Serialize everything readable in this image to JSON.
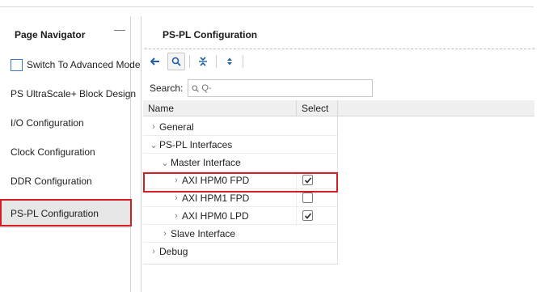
{
  "navigator": {
    "title": "Page Navigator",
    "minimize_icon": "minimize-icon",
    "items": [
      {
        "label": "Switch To Advanced Mode",
        "type": "checkbox",
        "checked": false
      },
      {
        "label": "PS UltraScale+ Block Design"
      },
      {
        "label": "I/O Configuration"
      },
      {
        "label": "Clock Configuration"
      },
      {
        "label": "DDR Configuration"
      },
      {
        "label": "PS-PL Configuration",
        "selected": true
      }
    ]
  },
  "config": {
    "title": "PS-PL Configuration",
    "toolbar": {
      "icons": [
        "back-arrow-icon",
        "search-icon",
        "collapse-all-icon",
        "expand-all-icon"
      ]
    },
    "search": {
      "label": "Search:",
      "value": "",
      "placeholder": "Q-"
    },
    "columns": {
      "name": "Name",
      "select": "Select"
    },
    "rows": [
      {
        "label": "General",
        "caret": "›",
        "level": 0,
        "expanded": false
      },
      {
        "label": "PS-PL Interfaces",
        "caret": "⌄",
        "level": 0,
        "expanded": true
      },
      {
        "label": "Master Interface",
        "caret": "⌄",
        "level": 1,
        "expanded": true
      },
      {
        "label": "AXI HPM0 FPD",
        "caret": "›",
        "level": 2,
        "checked": true
      },
      {
        "label": "AXI HPM1 FPD",
        "caret": "›",
        "level": 2,
        "checked": false
      },
      {
        "label": "AXI HPM0 LPD",
        "caret": "›",
        "level": 2,
        "checked": true
      },
      {
        "label": "Slave Interface",
        "caret": "›",
        "level": 1,
        "expanded": false
      },
      {
        "label": "Debug",
        "caret": "›",
        "level": 0,
        "expanded": false
      }
    ]
  },
  "colors": {
    "highlight": "#d41e24",
    "checkbox_blue": "#3a78c3",
    "selected_bg": "#e7e7e7",
    "toolbar_blue": "#1f5fae"
  }
}
